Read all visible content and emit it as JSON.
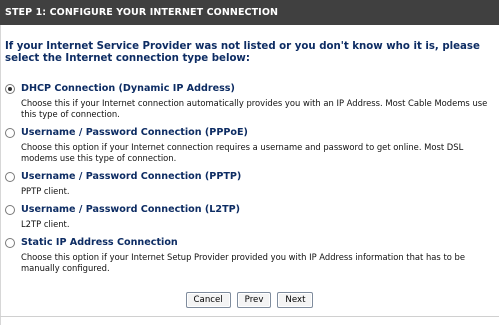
{
  "header": {
    "title": "STEP 1: CONFIGURE YOUR INTERNET CONNECTION"
  },
  "intro": "If your Internet Service Provider was not listed or you don't know who it is, please select the Internet connection type below:",
  "options": [
    {
      "title": "DHCP Connection (Dynamic IP Address)",
      "desc": "Choose this if your Internet connection automatically provides you with an IP Address. Most Cable Modems use this type of connection.",
      "checked": true
    },
    {
      "title": "Username / Password Connection (PPPoE)",
      "desc": "Choose this option if your Internet connection requires a username and password to get online. Most DSL modems use this type of connection.",
      "checked": false
    },
    {
      "title": "Username / Password Connection (PPTP)",
      "desc": "PPTP client.",
      "checked": false
    },
    {
      "title": "Username / Password Connection (L2TP)",
      "desc": "L2TP client.",
      "checked": false
    },
    {
      "title": "Static IP Address Connection",
      "desc": "Choose this option if your Internet Setup Provider provided you with IP Address information that has to be manually configured.",
      "checked": false
    }
  ],
  "buttons": {
    "cancel": "Cancel",
    "prev": "Prev",
    "next": "Next"
  }
}
